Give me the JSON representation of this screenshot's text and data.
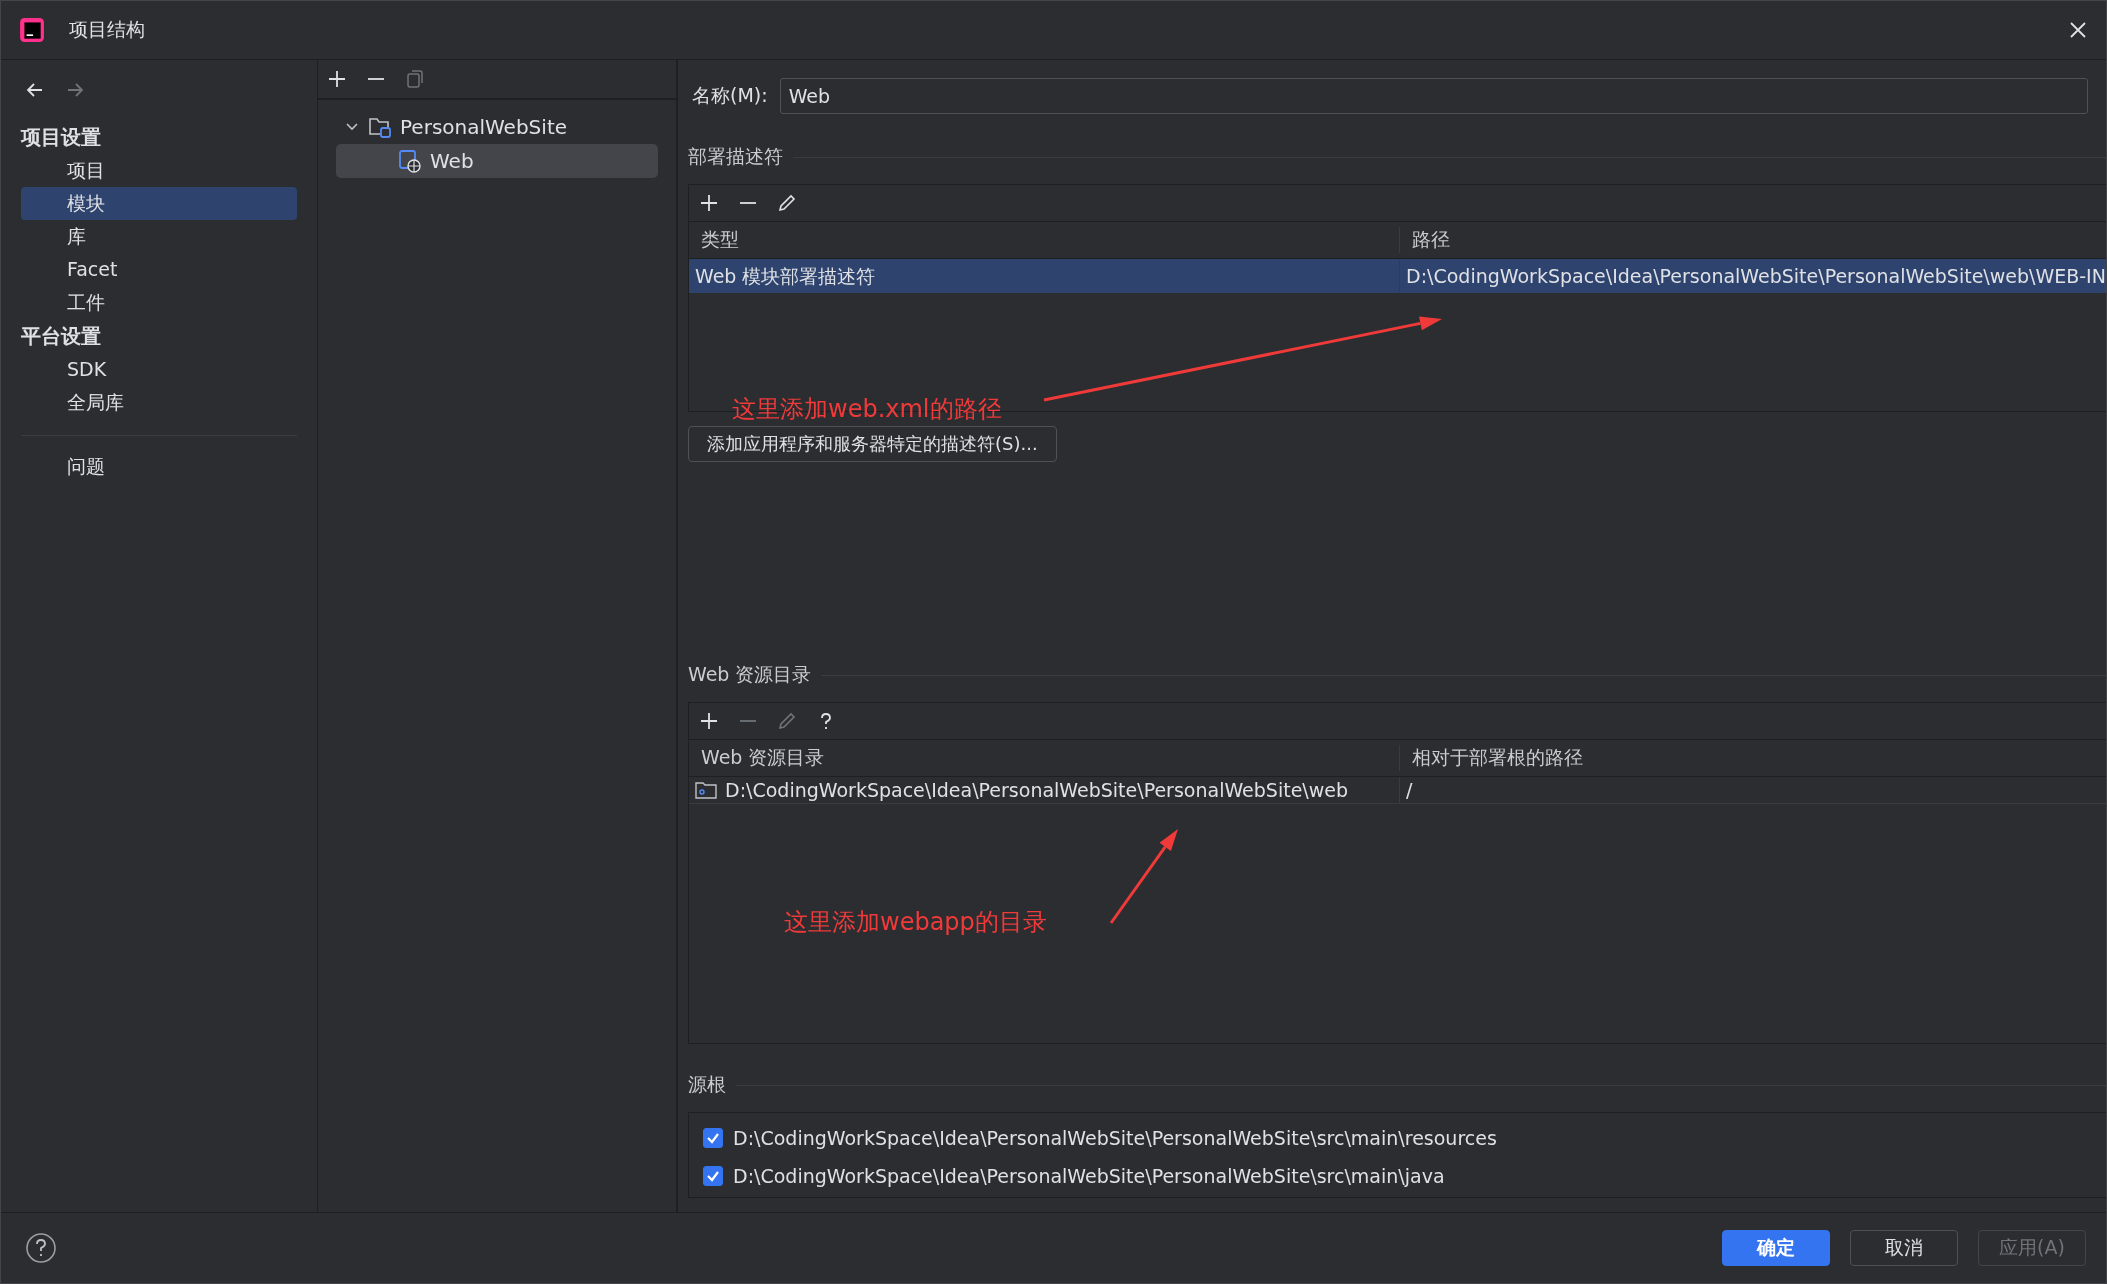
{
  "window": {
    "title": "项目结构"
  },
  "nav": {
    "back_disabled": false,
    "forward_disabled": true
  },
  "sidebar": {
    "sections": [
      {
        "heading": "项目设置",
        "items": [
          {
            "label": "项目",
            "selected": false
          },
          {
            "label": "模块",
            "selected": true
          },
          {
            "label": "库",
            "selected": false
          },
          {
            "label": "Facet",
            "selected": false
          },
          {
            "label": "工件",
            "selected": false
          }
        ]
      },
      {
        "heading": "平台设置",
        "items": [
          {
            "label": "SDK",
            "selected": false
          },
          {
            "label": "全局库",
            "selected": false
          }
        ]
      }
    ],
    "extra_items": [
      {
        "label": "问题",
        "selected": false
      }
    ]
  },
  "tree": {
    "toolbar": [
      {
        "kind": "add",
        "disabled": false
      },
      {
        "kind": "remove",
        "disabled": false
      },
      {
        "kind": "copy",
        "disabled": true
      }
    ],
    "nodes": [
      {
        "label": "PersonalWebSite",
        "kind": "project",
        "expanded": true,
        "selected": false,
        "children": [
          {
            "label": "Web",
            "kind": "module",
            "selected": true
          }
        ]
      }
    ]
  },
  "name_field": {
    "label": "名称(M):",
    "value": "Web"
  },
  "descriptors": {
    "title": "部署描述符",
    "toolbar": [
      {
        "kind": "add",
        "disabled": false
      },
      {
        "kind": "remove",
        "disabled": false
      },
      {
        "kind": "edit",
        "disabled": false
      }
    ],
    "columns": [
      "类型",
      "路径"
    ],
    "rows": [
      {
        "cells": [
          "Web 模块部署描述符",
          "D:\\CodingWorkSpace\\Idea\\PersonalWebSite\\PersonalWebSite\\web\\WEB-IN"
        ],
        "selected": true
      }
    ],
    "add_button": "添加应用程序和服务器特定的描述符(S)..."
  },
  "resources": {
    "title": "Web 资源目录",
    "toolbar": [
      {
        "kind": "add",
        "disabled": false
      },
      {
        "kind": "remove",
        "disabled": true
      },
      {
        "kind": "edit",
        "disabled": true
      },
      {
        "kind": "help",
        "disabled": false
      }
    ],
    "columns": [
      "Web 资源目录",
      "相对于部署根的路径"
    ],
    "rows": [
      {
        "cells": [
          "D:\\CodingWorkSpace\\Idea\\PersonalWebSite\\PersonalWebSite\\web",
          "/"
        ],
        "selected": false
      }
    ]
  },
  "source_roots": {
    "title": "源根",
    "items": [
      {
        "path": "D:\\CodingWorkSpace\\Idea\\PersonalWebSite\\PersonalWebSite\\src\\main\\resources",
        "checked": true
      },
      {
        "path": "D:\\CodingWorkSpace\\Idea\\PersonalWebSite\\PersonalWebSite\\src\\main\\java",
        "checked": true
      }
    ]
  },
  "annotations": [
    {
      "text": "这里添加web.xml的路径",
      "color": "#f03a3a"
    },
    {
      "text": "这里添加webapp的目录",
      "color": "#f03a3a"
    }
  ],
  "buttons": [
    {
      "label": "确定",
      "kind": "primary"
    },
    {
      "label": "取消",
      "kind": "normal"
    },
    {
      "label": "应用(A)",
      "kind": "disabled"
    }
  ]
}
